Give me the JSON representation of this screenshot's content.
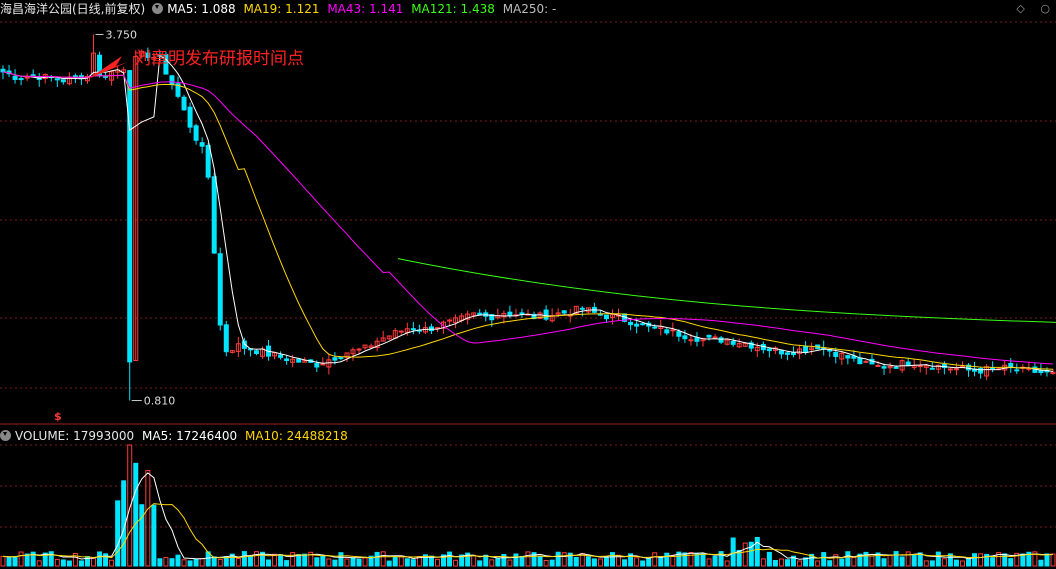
{
  "header": {
    "title": "海昌海洋公园(日线,前复权)",
    "ma5": "MA5: 1.088",
    "ma19": "MA19: 1.121",
    "ma43": "MA43: 1.141",
    "ma121": "MA121: 1.438",
    "ma250": "MA250: -"
  },
  "volume_header": {
    "volume": "VOLUME: 17993000",
    "ma5": "MA5: 17246400",
    "ma10": "MA10: 24488218"
  },
  "icons": {
    "diamond": "diamond-icon",
    "circle": "circle-icon",
    "dropdown": "chevron-down-icon"
  },
  "colors": {
    "up": "#ff3c3c",
    "down": "#00e5ff",
    "ma5": "#ffffff",
    "ma19": "#ffd700",
    "ma43": "#ff00ff",
    "ma121": "#39ff14",
    "grid": "#7a1c1c",
    "annotation": "#ff2222"
  },
  "chart_data": {
    "type": "candlestick",
    "annotation": "刘章明发布研报时间点",
    "high_label": "3.750",
    "low_label": "0.810",
    "price_range": [
      0.75,
      3.85
    ],
    "marker": "$",
    "key_points": [
      {
        "label": "peak",
        "value": 3.75
      },
      {
        "label": "low",
        "value": 0.81
      }
    ],
    "approx_close_path": [
      3.45,
      3.4,
      3.42,
      3.4,
      3.38,
      3.42,
      3.4,
      3.45,
      3.5,
      3.6,
      3.55,
      3.3,
      3.0,
      2.75,
      1.2,
      1.25,
      1.22,
      1.18,
      1.15,
      1.12,
      1.1,
      1.15,
      1.2,
      1.22,
      1.3,
      1.35,
      1.4,
      1.38,
      1.42,
      1.45,
      1.5,
      1.48,
      1.52,
      1.5,
      1.48,
      1.5,
      1.52,
      1.55,
      1.5,
      1.48,
      1.45,
      1.4,
      1.38,
      1.35,
      1.32,
      1.3,
      1.3,
      1.28,
      1.25,
      1.22,
      1.2,
      1.22,
      1.25,
      1.2,
      1.15,
      1.1,
      1.08,
      1.1,
      1.12,
      1.1,
      1.08,
      1.06,
      1.05,
      1.06,
      1.07,
      1.05,
      1.04,
      1.02
    ],
    "ma121_range": [
      1.95,
      1.438
    ],
    "volume_ma5": 17246400,
    "volume_ma10": 24488218,
    "last_volume": 17993000
  }
}
